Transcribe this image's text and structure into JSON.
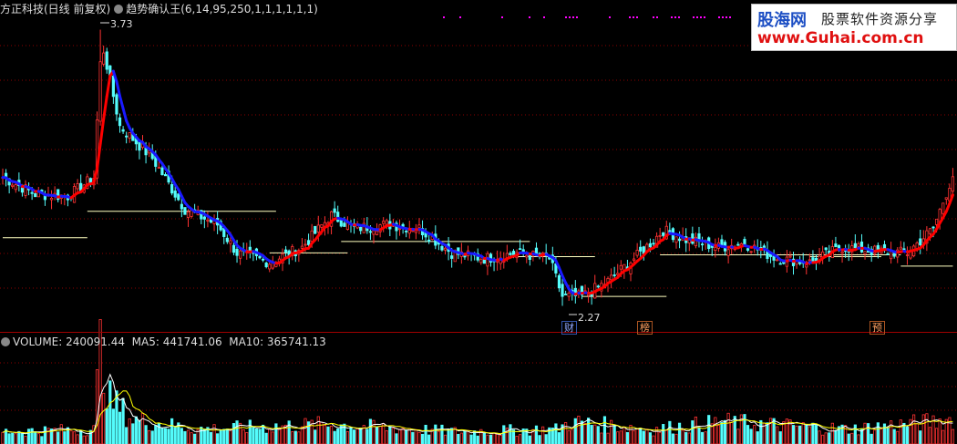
{
  "price_header": {
    "stock_label": "方正科技(日线 前复权)",
    "indicator_label": "趋势确认王(6,14,95,250,1,1,1,1,1,1)"
  },
  "volume_header": {
    "volume_label": "VOLUME: 240091.44",
    "ma5_label": "MA5: 441741.06",
    "ma10_label": "MA10: 365741.13"
  },
  "watermark": {
    "brand": "股海网",
    "slogan": "股票软件资源分享",
    "url": "www.Guhai.com.cn"
  },
  "annotations": {
    "high_label": "3.73",
    "low_label": "2.27",
    "event_tags": [
      "财",
      "榜",
      "预"
    ]
  },
  "colors": {
    "background": "#000000",
    "up": "#ff3232",
    "down": "#54fcfc",
    "trend_up": "#ff0000",
    "trend_down": "#1a1aff",
    "support_line": "#ffffc0",
    "grid": "#8b0000",
    "vol_ma5": "#ffffff",
    "vol_ma10": "#ffff00",
    "dots": "#ff00ff"
  },
  "chart_data": [
    {
      "type": "candlestick",
      "title": "方正科技(日线 前复权)",
      "period": "daily",
      "ylim": [
        2.2,
        3.8
      ],
      "grid": true,
      "annotations": [
        {
          "label": "3.73",
          "note": "period high"
        },
        {
          "label": "2.27",
          "note": "period low"
        }
      ],
      "anchor_closes": [
        [
          0,
          2.95
        ],
        [
          10,
          2.86
        ],
        [
          20,
          2.85
        ],
        [
          28,
          2.95
        ],
        [
          30,
          3.55
        ],
        [
          31,
          3.62
        ],
        [
          36,
          3.22
        ],
        [
          46,
          3.05
        ],
        [
          56,
          2.78
        ],
        [
          66,
          2.7
        ],
        [
          72,
          2.55
        ],
        [
          82,
          2.5
        ],
        [
          92,
          2.58
        ],
        [
          101,
          2.75
        ],
        [
          108,
          2.68
        ],
        [
          118,
          2.7
        ],
        [
          128,
          2.68
        ],
        [
          138,
          2.55
        ],
        [
          148,
          2.52
        ],
        [
          158,
          2.55
        ],
        [
          168,
          2.52
        ],
        [
          172,
          2.32
        ],
        [
          178,
          2.32
        ],
        [
          186,
          2.4
        ],
        [
          196,
          2.55
        ],
        [
          203,
          2.67
        ],
        [
          210,
          2.62
        ],
        [
          220,
          2.58
        ],
        [
          228,
          2.6
        ],
        [
          238,
          2.52
        ],
        [
          248,
          2.5
        ],
        [
          258,
          2.58
        ],
        [
          268,
          2.56
        ],
        [
          278,
          2.55
        ],
        [
          286,
          2.68
        ],
        [
          292,
          2.96
        ]
      ],
      "support_levels": [
        {
          "range": [
            0,
            26
          ],
          "value": 2.63
        },
        {
          "range": [
            26,
            84
          ],
          "value": 2.77
        },
        {
          "range": [
            82,
            106
          ],
          "value": 2.55
        },
        {
          "range": [
            104,
            162
          ],
          "value": 2.61
        },
        {
          "range": [
            156,
            182
          ],
          "value": 2.53
        },
        {
          "range": [
            178,
            204
          ],
          "value": 2.32
        },
        {
          "range": [
            202,
            276
          ],
          "value": 2.54
        },
        {
          "range": [
            248,
            270
          ],
          "value": 2.53
        },
        {
          "range": [
            276,
            292
          ],
          "value": 2.48
        }
      ]
    },
    {
      "type": "bar",
      "title": "VOLUME",
      "series": [
        {
          "name": "VOLUME",
          "last": 240091.44
        },
        {
          "name": "MA5",
          "last": 441741.06
        },
        {
          "name": "MA10",
          "last": 365741.13
        }
      ],
      "volume_anchors": [
        [
          0,
          5
        ],
        [
          28,
          6
        ],
        [
          30,
          40
        ],
        [
          31,
          33
        ],
        [
          33,
          18
        ],
        [
          40,
          10
        ],
        [
          60,
          6
        ],
        [
          80,
          7
        ],
        [
          100,
          8
        ],
        [
          140,
          5
        ],
        [
          170,
          6
        ],
        [
          175,
          9
        ],
        [
          200,
          6
        ],
        [
          222,
          9
        ],
        [
          260,
          6
        ],
        [
          285,
          9
        ],
        [
          292,
          10
        ]
      ]
    }
  ]
}
